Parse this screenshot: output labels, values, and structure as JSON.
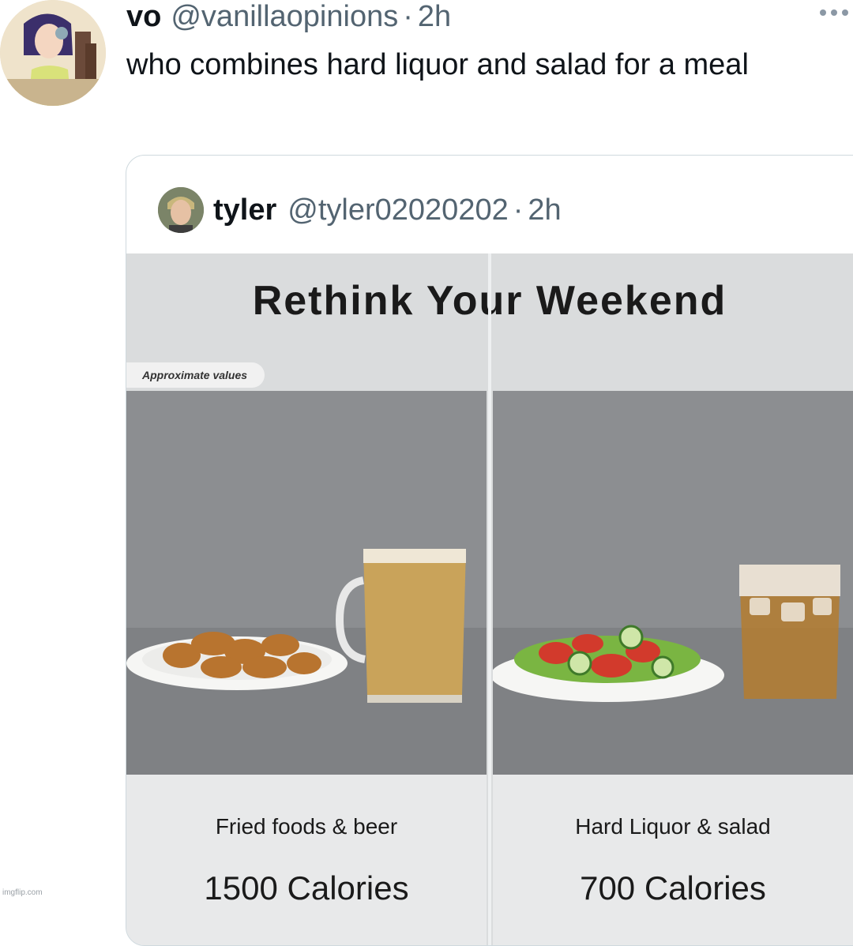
{
  "tweet": {
    "display_name": "vo",
    "handle": "@vanillaopinions",
    "separator": "·",
    "time": "2h",
    "text": "who combines hard liquor and salad for a meal"
  },
  "quoted_tweet": {
    "display_name": "tyler",
    "handle": "@tyler02020202",
    "separator": "·",
    "time": "2h"
  },
  "infographic": {
    "title": "Rethink Your Weekend",
    "tag": "Approximate values",
    "left": {
      "label": "Fried foods & beer",
      "calories": "1500 Calories"
    },
    "right": {
      "label": "Hard Liquor & salad",
      "calories": "700 Calories"
    }
  },
  "watermark": "imgflip.com",
  "icons": {
    "more": "more-horizontal-icon"
  }
}
